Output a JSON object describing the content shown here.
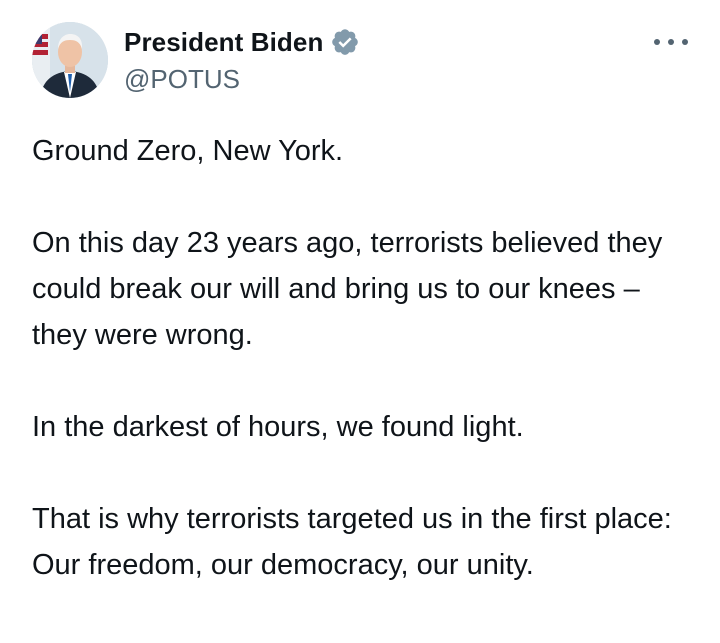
{
  "author": {
    "display_name": "President Biden",
    "handle": "@POTUS",
    "verified_icon": "verified-badge-icon",
    "verified_color": "#829aab",
    "avatar_icon": "profile-photo"
  },
  "menu": {
    "icon": "more-options-icon"
  },
  "tweet": {
    "paragraphs": [
      "Ground Zero, New York.",
      "On this day 23 years ago, terrorists believed they could break our will and bring us to our knees – they were wrong.",
      "In the darkest of hours, we found light.",
      "That is why terrorists targeted us in the first place: Our freedom, our democracy, our unity."
    ]
  },
  "colors": {
    "text": "#0f1419",
    "secondary_text": "#536471",
    "background": "#ffffff"
  }
}
